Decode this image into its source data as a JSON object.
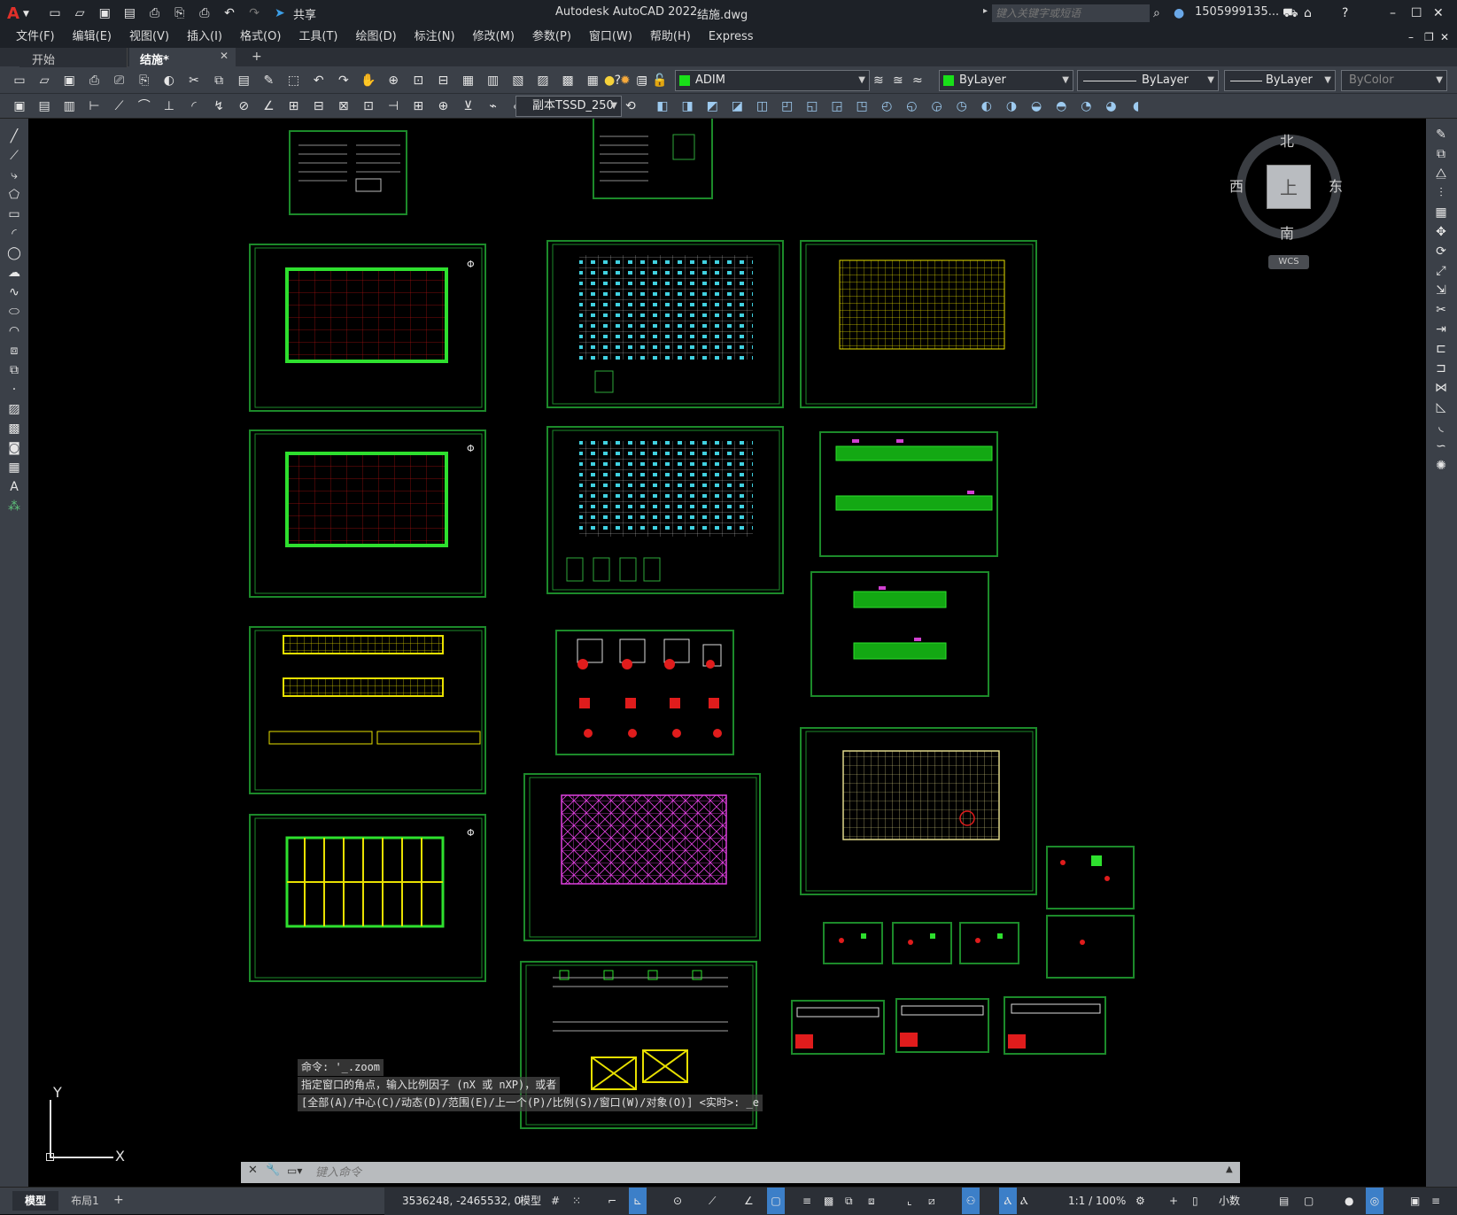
{
  "app": {
    "title": "Autodesk AutoCAD 2022",
    "filename": "结施.dwg",
    "share_label": "共享",
    "search_placeholder": "键入关键字或短语",
    "user": "1505999135...",
    "accent": "#1c8a2a"
  },
  "menu": [
    "文件(F)",
    "编辑(E)",
    "视图(V)",
    "插入(I)",
    "格式(O)",
    "工具(T)",
    "绘图(D)",
    "标注(N)",
    "修改(M)",
    "参数(P)",
    "窗口(W)",
    "帮助(H)",
    "Express"
  ],
  "tabs": [
    {
      "label": "开始",
      "active": false
    },
    {
      "label": "结施*",
      "active": true
    }
  ],
  "toolbar": {
    "layer_name": "ADIM",
    "color": "ByLayer",
    "linetype": "ByLayer",
    "lineweight": "ByLayer",
    "plotstyle": "ByColor",
    "textstyle": "副本TSSD_250"
  },
  "viewcube": {
    "north": "北",
    "south": "南",
    "east": "东",
    "west": "西",
    "top": "上",
    "wcs": "WCS"
  },
  "ucs": {
    "x": "X",
    "y": "Y"
  },
  "command": {
    "history": [
      "命令: '_.zoom",
      "指定窗口的角点，输入比例因子 (nX 或 nXP)，或者",
      "[全部(A)/中心(C)/动态(D)/范围(E)/上一个(P)/比例(S)/窗口(W)/对象(O)] <实时>: _e"
    ],
    "placeholder": "键入命令"
  },
  "layout_tabs": [
    {
      "label": "模型",
      "active": true
    },
    {
      "label": "布局1",
      "active": false
    }
  ],
  "status": {
    "coords": "3536248, -2465532, 0",
    "space": "模型",
    "scale": "1:1 / 100%",
    "units": "小数"
  }
}
